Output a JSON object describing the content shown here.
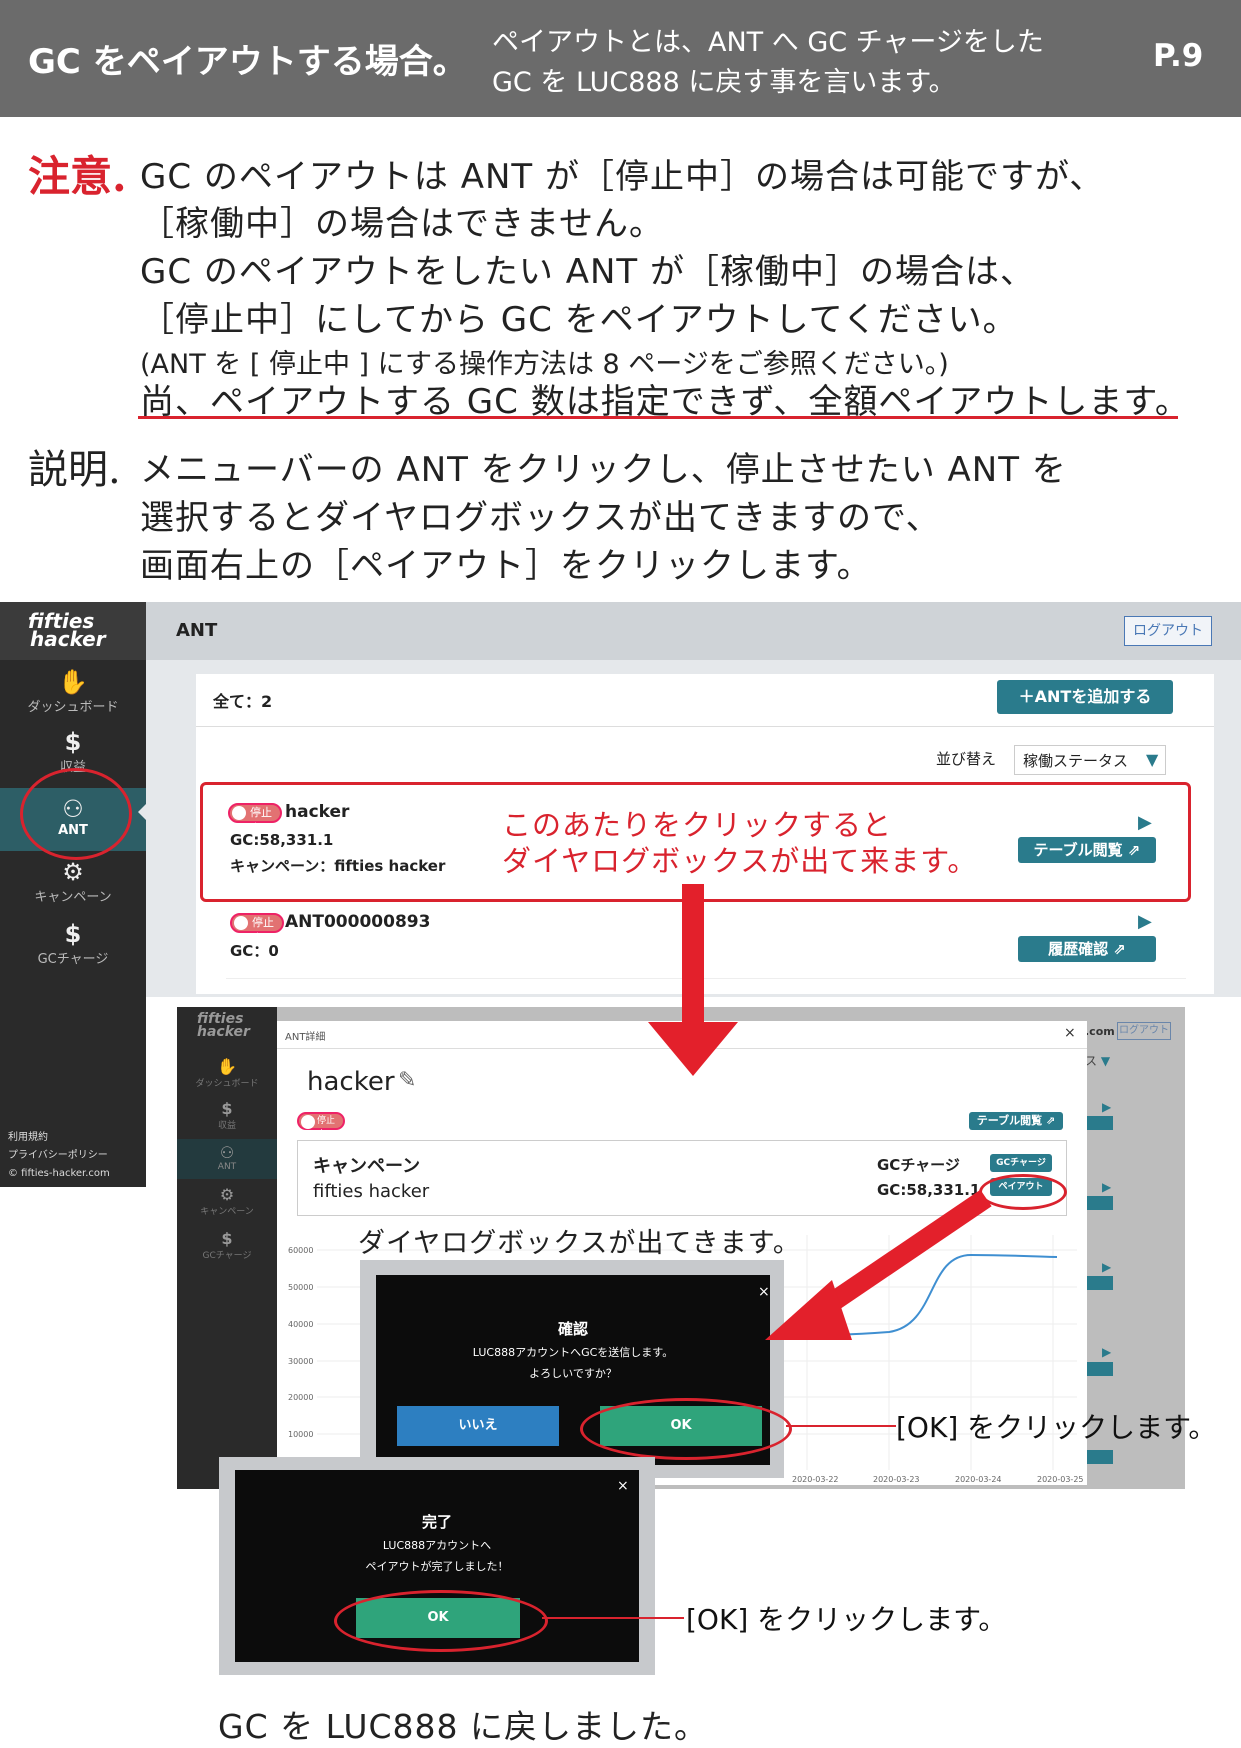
{
  "header": {
    "title": "GC をペイアウトする場合。",
    "subtitle_line1": "ペイアウトとは、ANT へ GC チャージをした",
    "subtitle_line2": "GC を LUC888 に戻す事を言います。",
    "page": "P.9"
  },
  "note": {
    "heading": "注意.",
    "lines": [
      "GC のペイアウトは ANT が［停止中］の場合は可能ですが、",
      "［稼働中］の場合はできません。",
      "GC のペイアウトをしたい ANT が［稼働中］の場合は、",
      "［停止中］にしてから GC をペイアウトしてください。",
      "(ANT を [ 停止中 ] にする操作方法は 8 ページをご参照ください。)",
      "尚、ペイアウトする GC 数は指定できず、全額ペイアウトします。"
    ]
  },
  "explanation": {
    "heading": "説明.",
    "lines": [
      "メニューバーの ANT をクリックし、停止させたい ANT を",
      "選択するとダイヤログボックスが出てきますので、",
      "画面右上の［ペイアウト］をクリックします。"
    ]
  },
  "app": {
    "logo_line1": "fifties",
    "logo_line2": "hacker",
    "page_title": "ANT",
    "logout": "ログアウト",
    "sidebar": [
      {
        "label": "ダッシュボード",
        "icon": "handshake-icon",
        "glyph": "✋"
      },
      {
        "label": "収益",
        "icon": "money-bag-icon",
        "glyph": "$"
      },
      {
        "label": "ANT",
        "icon": "robot-icon",
        "glyph": "⚇"
      },
      {
        "label": "キャンペーン",
        "icon": "gear-head-icon",
        "glyph": "⚙"
      },
      {
        "label": "GCチャージ",
        "icon": "coin-icon",
        "glyph": "$"
      }
    ],
    "footer_links": [
      "利用規約",
      "プライバシーポリシー",
      "© fifties-hacker.com"
    ],
    "total": "全て：2",
    "add_button": "＋ANTを追加する",
    "sort_label": "並び替え",
    "sort_value": "稼働ステータス",
    "ants": [
      {
        "status": "停止中",
        "name": "hacker",
        "gc": "GC:58,331.1",
        "campaign": "キャンペーン：fifties hacker",
        "button": "テーブル閲覧 ⇗"
      },
      {
        "status": "停止中",
        "name": "ANT000000893",
        "gc": "GC：0",
        "campaign": "",
        "button": "履歴確認 ⇗"
      }
    ]
  },
  "callout1": {
    "line1": "このあたりをクリックすると",
    "line2": "ダイヤログボックスが出て来ます。"
  },
  "modal": {
    "header": "ANT詳細",
    "name": "hacker",
    "status": "停止中",
    "table_button": "テーブル閲覧 ⇗",
    "campaign_label": "キャンペーン",
    "campaign_value": "fifties hacker",
    "gc_charge_label": "GCチャージ",
    "gc_value": "GC:58,331.1",
    "charge_button": "GCチャージ",
    "payout_button": "ペイアウト",
    "y_ticks": [
      "60000",
      "50000",
      "40000",
      "30000",
      "20000",
      "10000"
    ],
    "x_ticks": [
      "2020-03-22",
      "2020-03-23",
      "2020-03-24",
      "2020-03-25"
    ],
    "right_partial_text": ".com",
    "right_logout": "ログアウト",
    "right_sort": "ス"
  },
  "annotation_dialog": "ダイヤログボックスが出てきます。",
  "confirm": {
    "title": "確認",
    "line1": "LUC888アカウントへGCを送信します。",
    "line2": "よろしいですか？",
    "no": "いいえ",
    "ok": "OK",
    "annotation": "[OK] をクリックします。"
  },
  "done": {
    "title": "完了",
    "line1": "LUC888アカウントへ",
    "line2": "ペイアウトが完了しました！",
    "ok": "OK",
    "annotation": "[OK] をクリックします。"
  },
  "final": "GC を LUC888 に戻しました。",
  "colors": {
    "accent_red": "#d9232e",
    "teal": "#2a7b8c",
    "ok_green": "#2fa47b",
    "no_blue": "#2d7fc1",
    "header_gray": "#6b6b6b"
  }
}
